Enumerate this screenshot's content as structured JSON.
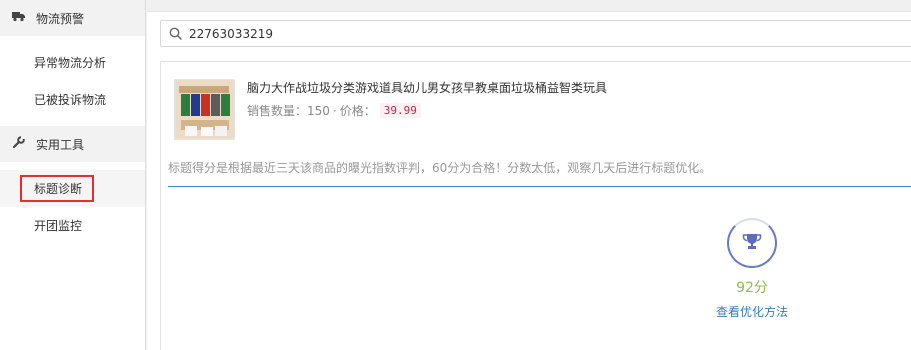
{
  "sidebar": {
    "sections": [
      {
        "label": "物流预警",
        "icon": "truck-icon",
        "items": [
          "异常物流分析",
          "已被投诉物流"
        ]
      },
      {
        "label": "实用工具",
        "icon": "wrench-icon",
        "items": [
          "标题诊断",
          "开团监控"
        ]
      }
    ],
    "active_item": "标题诊断"
  },
  "search": {
    "value": "22763033219",
    "icon": "search-icon"
  },
  "product": {
    "title": "脑力大作战垃圾分类游戏道具幼儿男女孩早教桌面垃圾桶益智类玩具",
    "sales_label": "销售数量：",
    "sales_value": "150",
    "separator": "·",
    "price_label": "价格：",
    "price_value": "39.99"
  },
  "note": "标题得分是根据最近三天该商品的曝光指数评判，60分为合格！分数太低，观察几天后进行标题优化。",
  "score": {
    "value": "92分",
    "link": "查看优化方法",
    "icon": "trophy-icon"
  },
  "colors": {
    "accent": "#3d8fd0",
    "score": "#8cbf4f",
    "price": "#c7254e",
    "highlight_box": "#e52e2e"
  }
}
